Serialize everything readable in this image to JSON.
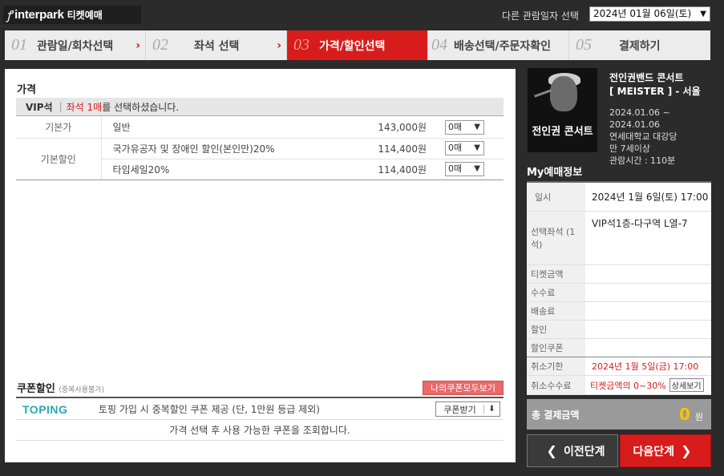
{
  "header": {
    "logo_text": "interpark",
    "logo_sub": "티켓예매",
    "date_label": "다른 관람일자 선택",
    "date_value": "2024년 01월 06일(토)"
  },
  "steps": [
    {
      "num": "01",
      "label": "관람일/회차선택",
      "active": false
    },
    {
      "num": "02",
      "label": "좌석 선택",
      "active": false
    },
    {
      "num": "03",
      "label": "가격/할인선택",
      "active": true
    },
    {
      "num": "04",
      "label": "배송선택/주문자확인",
      "active": false
    },
    {
      "num": "05",
      "label": "결제하기",
      "active": false
    }
  ],
  "price": {
    "section_title": "가격",
    "grade": "VIP석",
    "grade_sep": "|",
    "selected_prefix": "좌석 1매",
    "selected_suffix": "를 선택하셨습니다.",
    "rows": [
      {
        "category": "기본가",
        "name": "일반",
        "price": "143,000원",
        "qty": "0매"
      },
      {
        "category": "기본할인",
        "name": "국가유공자 및 장애인 할인(본인만)20%",
        "price": "114,400원",
        "qty": "0매"
      },
      {
        "category": "",
        "name": "타임세일20%",
        "price": "114,400원",
        "qty": "0매"
      }
    ]
  },
  "coupon": {
    "title": "쿠폰할인",
    "note_small": "(중복사용불가)",
    "my_coupons_button": "나의쿠폰모두보기",
    "toping_logo": "TOPING",
    "toping_desc": "토핑 가입 시 중복할인 쿠폰 제공 (단, 1만원 등급 제외)",
    "receive_button": "쿠폰받기",
    "info": "가격 선택 후 사용 가능한 쿠폰을 조회합니다."
  },
  "performance": {
    "poster_text": "전인권 콘서트",
    "title_line1": "전인권밴드 콘서트",
    "title_line2": "[ MEISTER ] - 서울",
    "period": "2024.01.06 ~ 2024.01.06",
    "venue": "연세대학교 대강당",
    "age": "만 7세이상",
    "runtime": "관람시간 : 110분"
  },
  "my_booking": {
    "title": "My예매정보",
    "rows": [
      {
        "key": "일시",
        "value": "2024년 1월 6일(토) 17:00"
      },
      {
        "key": "선택좌석 (1석)",
        "value": "VIP석1층-다구역 L열-7"
      },
      {
        "key": "티켓금액",
        "value": ""
      },
      {
        "key": "수수료",
        "value": ""
      },
      {
        "key": "배송료",
        "value": ""
      },
      {
        "key": "할인",
        "value": ""
      },
      {
        "key": "할인쿠폰",
        "value": ""
      },
      {
        "key": "취소기한",
        "value": "2024년 1월 5일(금) 17:00"
      },
      {
        "key": "취소수수료",
        "value": "티켓금액의 0~30%"
      }
    ],
    "detail_button": "상세보기",
    "total_label": "총 결제금액",
    "total_amount": "0",
    "total_unit": "원",
    "prev_button": "이전단계",
    "next_button": "다음단계"
  }
}
